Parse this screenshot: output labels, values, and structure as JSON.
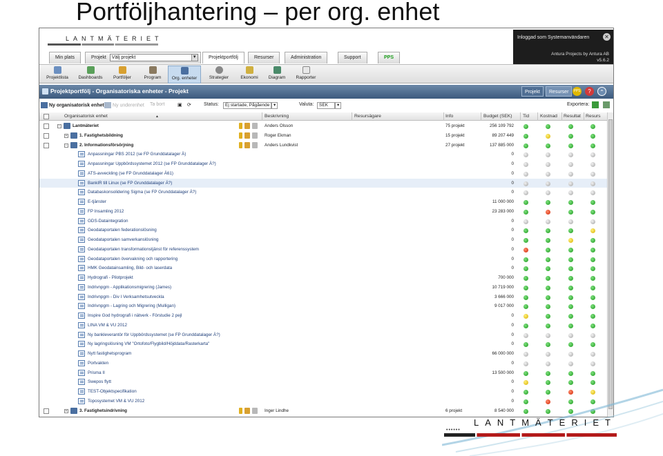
{
  "slide": {
    "title": "Portföljhantering – per org. enhet"
  },
  "header": {
    "logo": "LANTMÄTERIET",
    "login_text": "Inloggad som Systemanvändaren",
    "product": "Antura Projects by Antura AB",
    "version": "v5.6.2"
  },
  "tabs": {
    "min_plats": "Min plats",
    "projekt": "Projekt",
    "projekt_select": "Välj projekt",
    "projektportfolj": "Projektportfölj",
    "resurser": "Resurser",
    "administration": "Administration",
    "support": "Support",
    "pps": "PPS"
  },
  "toolbar": {
    "items": [
      "Projektlista",
      "Dashboards",
      "Portföljer",
      "Program",
      "Org. enheter",
      "Strategier",
      "Ekonomi",
      "Diagram",
      "Rapporter"
    ]
  },
  "titlebar": {
    "title": "Projektportfölj - Organisatoriska enheter - Projekt",
    "btn_projekt": "Projekt",
    "btn_resurser": "Resurser",
    "pps": "PPS",
    "help": "?",
    "up": "⌃"
  },
  "filter": {
    "new_unit": "Ny organisatorisk enhet",
    "new_subunit": "Ny underenhet",
    "remove": "Ta bort",
    "status_label": "Status:",
    "status_value": "Ej startade, Pågående",
    "currency_label": "Valuta:",
    "currency_value": "SEK",
    "export_label": "Exportera:"
  },
  "columns": {
    "org": "Organisatorisk enhet",
    "desc": "Beskrivning",
    "owner": "Resursägare",
    "info": "Info",
    "budget": "Budget (SEK)",
    "time": "Tid",
    "cost": "Kostnad",
    "result": "Resultat",
    "resource": "Resurs"
  },
  "rows": [
    {
      "level": 0,
      "kind": "org",
      "name": "Lantmäteriet",
      "desc": "Anders Olsson",
      "info": "75 projekt",
      "budget": "256 109 792",
      "s": [
        "g",
        "g",
        "g",
        "g"
      ]
    },
    {
      "level": 1,
      "kind": "org",
      "name": "1. Fastighetsbildning",
      "desc": "Roger Ekman",
      "info": "15 projekt",
      "budget": "89 207 449",
      "s": [
        "g",
        "y",
        "g",
        "g"
      ]
    },
    {
      "level": 1,
      "kind": "org",
      "name": "2. Informationsförsörjning",
      "desc": "Anders Lundkvist",
      "info": "27 projekt",
      "budget": "137 885 000",
      "s": [
        "g",
        "g",
        "g",
        "g"
      ]
    },
    {
      "level": 2,
      "kind": "proj",
      "name": "Anpassningar PBS 2012 (se FP Grunddatalager Ä)",
      "budget": "0",
      "s": [
        "x",
        "x",
        "x",
        "x"
      ]
    },
    {
      "level": 2,
      "kind": "proj",
      "name": "Anpassningar Uppbördssystemet 2012 (se FP Grunddatalager Ä?)",
      "budget": "0",
      "s": [
        "x",
        "x",
        "x",
        "x"
      ]
    },
    {
      "level": 2,
      "kind": "proj",
      "name": "ATS-avveckling (se FP Grunddatalager Ä61)",
      "budget": "0",
      "s": [
        "x",
        "x",
        "x",
        "x"
      ]
    },
    {
      "level": 2,
      "kind": "proj",
      "name": "BankIR till Linux (se FP Grunddatalager Ä?)",
      "budget": "0",
      "s": [
        "x",
        "x",
        "x",
        "x"
      ],
      "hl": true
    },
    {
      "level": 2,
      "kind": "proj",
      "name": "Databaskonsolidering Sigma (se FP Grunddatalager Ä?)",
      "budget": "0",
      "s": [
        "x",
        "x",
        "x",
        "x"
      ]
    },
    {
      "level": 2,
      "kind": "proj",
      "name": "E-tjänster",
      "budget": "11 000 000",
      "s": [
        "g",
        "g",
        "g",
        "g"
      ]
    },
    {
      "level": 2,
      "kind": "proj",
      "name": "FP Insamling 2012",
      "budget": "23 283 000",
      "s": [
        "g",
        "r",
        "g",
        "g"
      ]
    },
    {
      "level": 2,
      "kind": "proj",
      "name": "GDS-Dataintegration",
      "budget": "0",
      "s": [
        "x",
        "x",
        "x",
        "x"
      ]
    },
    {
      "level": 2,
      "kind": "proj",
      "name": "Geodataportalen federationslösning",
      "budget": "0",
      "s": [
        "g",
        "g",
        "g",
        "y"
      ]
    },
    {
      "level": 2,
      "kind": "proj",
      "name": "Geodataportalen samverkanslösning",
      "budget": "0",
      "s": [
        "g",
        "g",
        "y",
        "g"
      ]
    },
    {
      "level": 2,
      "kind": "proj",
      "name": "Geodataportalen transformationstjänst för referenssystem",
      "budget": "0",
      "s": [
        "r",
        "g",
        "g",
        "g"
      ]
    },
    {
      "level": 2,
      "kind": "proj",
      "name": "Geodataportalen övervakning och rapportering",
      "budget": "0",
      "s": [
        "g",
        "g",
        "g",
        "g"
      ]
    },
    {
      "level": 2,
      "kind": "proj",
      "name": "HMK Geodatainsamling, Bild- och laserdata",
      "budget": "0",
      "s": [
        "g",
        "g",
        "g",
        "g"
      ]
    },
    {
      "level": 2,
      "kind": "proj",
      "name": "Hydrografi - Pilotprojekt",
      "budget": "700 000",
      "s": [
        "g",
        "g",
        "g",
        "g"
      ]
    },
    {
      "level": 2,
      "kind": "proj",
      "name": "Indrivnpgm - Applikationsmigrering (James)",
      "budget": "10 719 000",
      "s": [
        "g",
        "g",
        "g",
        "g"
      ]
    },
    {
      "level": 2,
      "kind": "proj",
      "name": "Indrivnpgm - Div I Verksamhetsutveckla",
      "budget": "3 666 000",
      "s": [
        "g",
        "g",
        "g",
        "g"
      ]
    },
    {
      "level": 2,
      "kind": "proj",
      "name": "Indrivnpgm - Lagring och Migrering (Mulligan)",
      "budget": "9 017 000",
      "s": [
        "g",
        "g",
        "g",
        "g"
      ]
    },
    {
      "level": 2,
      "kind": "proj",
      "name": "Inspire God hydrografi i nätverk - Förstudie 2 pejl",
      "budget": "0",
      "s": [
        "y",
        "g",
        "g",
        "g"
      ]
    },
    {
      "level": 2,
      "kind": "proj",
      "name": "LINA VM & VU 2012",
      "budget": "0",
      "s": [
        "g",
        "g",
        "g",
        "g"
      ]
    },
    {
      "level": 2,
      "kind": "proj",
      "name": "Ny bankleverantör för Uppbördssystemet (se FP Grunddatalager Ä?)",
      "budget": "0",
      "s": [
        "x",
        "x",
        "x",
        "x"
      ]
    },
    {
      "level": 2,
      "kind": "proj",
      "name": "Ny lagringslösning VM \"Ortofoto/Flygbild/Höjddata/Rasterkarta\"",
      "budget": "0",
      "s": [
        "g",
        "g",
        "g",
        "g"
      ]
    },
    {
      "level": 2,
      "kind": "proj",
      "name": "Nytt fastighetsprogram",
      "budget": "66 000 000",
      "s": [
        "x",
        "x",
        "x",
        "x"
      ]
    },
    {
      "level": 2,
      "kind": "proj",
      "name": "Portvakten",
      "budget": "0",
      "s": [
        "x",
        "x",
        "x",
        "x"
      ]
    },
    {
      "level": 2,
      "kind": "proj",
      "name": "Prisma II",
      "budget": "13 500 000",
      "s": [
        "g",
        "g",
        "g",
        "g"
      ]
    },
    {
      "level": 2,
      "kind": "proj",
      "name": "Swepos flytt",
      "budget": "0",
      "s": [
        "y",
        "g",
        "g",
        "g"
      ]
    },
    {
      "level": 2,
      "kind": "proj",
      "name": "TEST-Objektspecifikation",
      "budget": "0",
      "s": [
        "g",
        "g",
        "r",
        "y"
      ]
    },
    {
      "level": 2,
      "kind": "proj",
      "name": "Toposystemet VM & VU 2012",
      "budget": "0",
      "s": [
        "g",
        "r",
        "g",
        "g"
      ]
    },
    {
      "level": 1,
      "kind": "org",
      "name": "3. Fastighetsindrivning",
      "desc": "Inger Lindhe",
      "info": "6 projekt",
      "budget": "8 540 000",
      "s": [
        "g",
        "g",
        "g",
        "g"
      ]
    }
  ],
  "footer": {
    "logo": "LANTMÄTERIET"
  }
}
